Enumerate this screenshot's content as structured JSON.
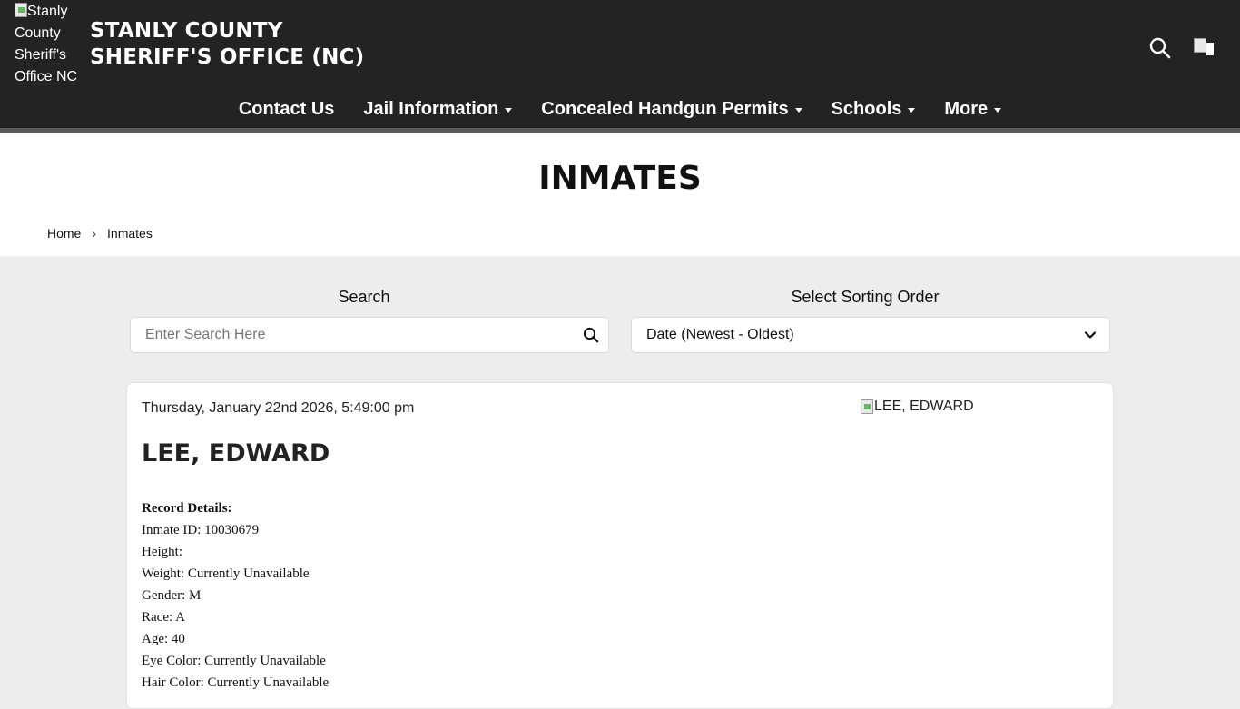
{
  "header": {
    "logo_alt": "Stanly County Sheriff's Office NC",
    "site_title_line1": "STANLY COUNTY",
    "site_title_line2": "SHERIFF'S OFFICE (NC)"
  },
  "nav": {
    "items": [
      {
        "label": "Contact Us",
        "has_dropdown": false
      },
      {
        "label": "Jail Information",
        "has_dropdown": true
      },
      {
        "label": "Concealed Handgun Permits",
        "has_dropdown": true
      },
      {
        "label": "Schools",
        "has_dropdown": true
      },
      {
        "label": "More",
        "has_dropdown": true
      }
    ]
  },
  "page": {
    "title": "INMATES",
    "breadcrumb": {
      "home": "Home",
      "separator": "›",
      "current": "Inmates"
    }
  },
  "filters": {
    "search_label": "Search",
    "search_placeholder": "Enter Search Here",
    "search_value": "",
    "sort_label": "Select Sorting Order",
    "sort_value": "Date (Newest - Oldest)"
  },
  "record": {
    "date": "Thursday, January 22nd 2026, 5:49:00 pm",
    "photo_alt": "LEE, EDWARD",
    "name": "LEE, EDWARD",
    "details_heading": "Record Details:",
    "details": [
      "Inmate ID: 10030679",
      "Height:",
      "Weight: Currently Unavailable",
      "Gender: M",
      "Race: A",
      "Age: 40",
      "Eye Color: Currently Unavailable",
      "Hair Color: Currently Unavailable"
    ]
  },
  "icons": {
    "header_search": "search-icon",
    "header_flag": "flag-icon",
    "search_field": "search-icon",
    "sort_dropdown": "chevron-down-icon",
    "nav_dropdown": "caret-down-icon"
  },
  "colors": {
    "header_bg": "#232323",
    "page_bg": "#ededed",
    "card_bg": "#ffffff",
    "text": "#111111"
  }
}
